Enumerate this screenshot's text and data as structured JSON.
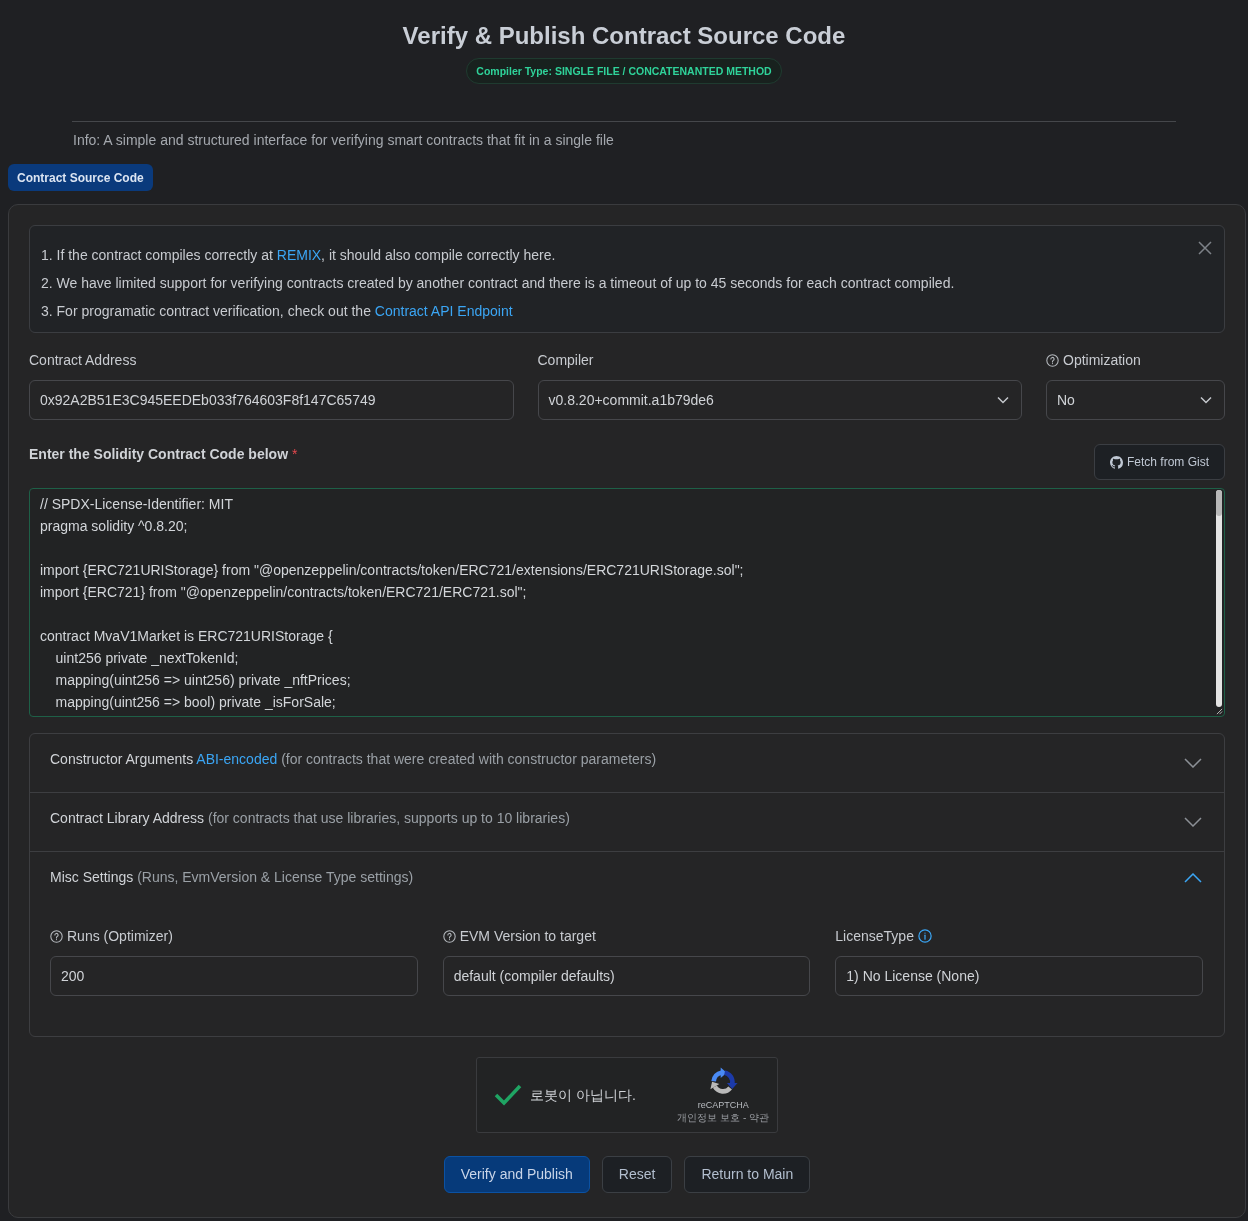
{
  "header": {
    "title": "Verify & Publish Contract Source Code",
    "badge": "Compiler Type: SINGLE FILE / CONCATENANTED METHOD",
    "info": "Info: A simple and structured interface for verifying smart contracts that fit in a single file"
  },
  "tabs": [
    {
      "label": "Contract Source Code",
      "selected": true
    }
  ],
  "notice": {
    "dismissible": true,
    "items": [
      {
        "parts": [
          {
            "kind": "text",
            "text": "1. If the contract compiles correctly at "
          },
          {
            "kind": "link",
            "text": "REMIX"
          },
          {
            "kind": "text",
            "text": ", it should also compile correctly here."
          }
        ]
      },
      {
        "parts": [
          {
            "kind": "text",
            "text": "2. We have limited support for verifying contracts created by another contract and there is a timeout of up to 45 seconds for each contract compiled."
          }
        ]
      },
      {
        "parts": [
          {
            "kind": "text",
            "text": "3. For programatic contract verification, check out the "
          },
          {
            "kind": "link",
            "text": "Contract API Endpoint"
          }
        ]
      }
    ]
  },
  "fields": [
    {
      "label": "Contract Address",
      "kind": "input",
      "value": "0x92A2B51E3C945EEDEb033f764603F8f147C65749",
      "help": false,
      "info": false
    },
    {
      "label": "Compiler",
      "kind": "select",
      "value": "v0.8.20+commit.a1b79de6",
      "help": false,
      "info": false
    },
    {
      "label": "Optimization",
      "kind": "select",
      "value": "No",
      "help": true,
      "info": false
    }
  ],
  "code_section": {
    "label": "Enter the Solidity Contract Code below",
    "required": "*",
    "button": "Fetch from Gist",
    "code": "// SPDX-License-Identifier: MIT\npragma solidity ^0.8.20;\n\nimport {ERC721URIStorage} from \"@openzeppelin/contracts/token/ERC721/extensions/ERC721URIStorage.sol\";\nimport {ERC721} from \"@openzeppelin/contracts/token/ERC721/ERC721.sol\";\n\ncontract MvaV1Market is ERC721URIStorage {\n    uint256 private _nextTokenId;\n    mapping(uint256 => uint256) private _nftPrices;\n    mapping(uint256 => bool) private _isForSale;"
  },
  "sections": [
    {
      "expanded": false,
      "parts": [
        {
          "kind": "title",
          "text": "Constructor Arguments "
        },
        {
          "kind": "link",
          "text": "ABI-encoded"
        },
        {
          "kind": "note",
          "text": " (for contracts that were created with constructor parameters)"
        }
      ]
    },
    {
      "expanded": false,
      "parts": [
        {
          "kind": "title",
          "text": "Contract Library Address "
        },
        {
          "kind": "note",
          "text": "(for contracts that use libraries, supports up to 10 libraries)"
        }
      ]
    },
    {
      "expanded": true,
      "parts": [
        {
          "kind": "title",
          "text": "Misc Settings "
        },
        {
          "kind": "note",
          "text": "(Runs, EvmVersion & License Type settings)"
        }
      ],
      "fields": [
        {
          "label": "Runs (Optimizer)",
          "kind": "input",
          "value": "200",
          "help": true,
          "info": false
        },
        {
          "label": "EVM Version to target",
          "kind": "input",
          "value": "default (compiler defaults)",
          "help": true,
          "info": false
        },
        {
          "label": "LicenseType",
          "kind": "input",
          "value": "1) No License (None)",
          "help": false,
          "info": true
        }
      ]
    }
  ],
  "captcha": {
    "checked": true,
    "label": "로봇이 아닙니다.",
    "brand": "reCAPTCHA",
    "footer": "개인정보 보호 - 약관"
  },
  "buttons": [
    {
      "label": "Verify and Publish",
      "kind": "primary"
    },
    {
      "label": "Reset",
      "kind": "secondary"
    },
    {
      "label": "Return to Main",
      "kind": "secondary"
    }
  ]
}
